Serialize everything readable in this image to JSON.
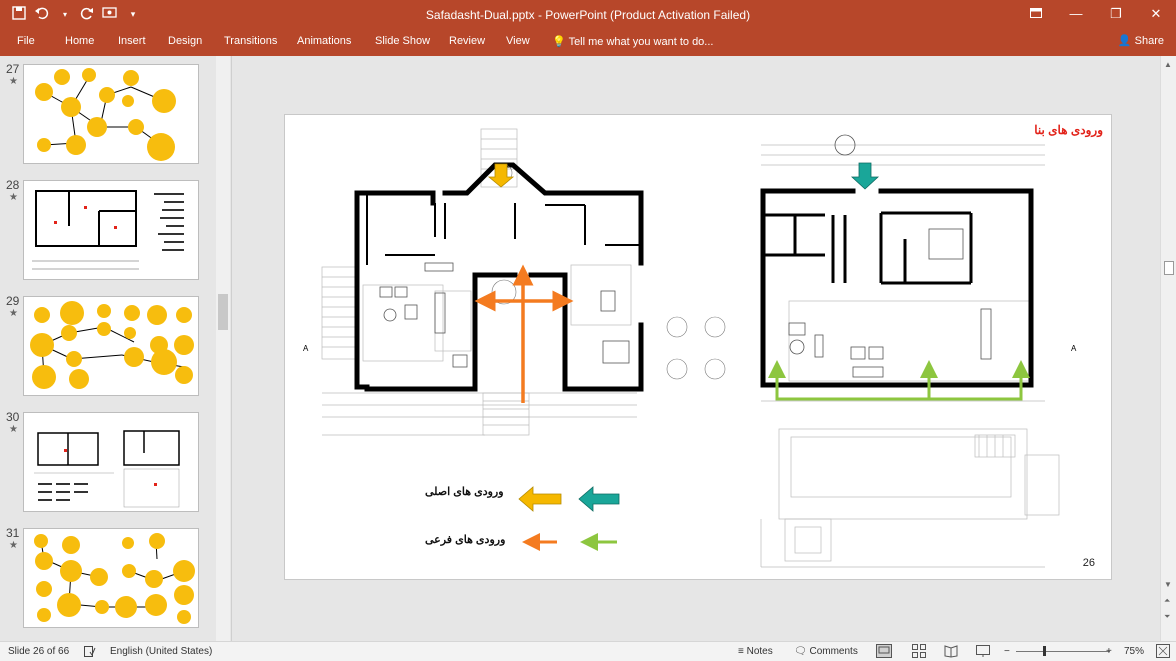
{
  "window": {
    "title": "Safadasht-Dual.pptx - PowerPoint (Product Activation Failed)"
  },
  "quick_access": {
    "save_icon": "save-icon",
    "undo_icon": "undo-icon",
    "redo_icon": "redo-icon",
    "customize_icon": "customize-qat-icon"
  },
  "ribbon": {
    "tabs": [
      "File",
      "Home",
      "Insert",
      "Design",
      "Transitions",
      "Animations",
      "Slide Show",
      "Review",
      "View"
    ],
    "tellme": "Tell me what you want to do...",
    "share": "Share"
  },
  "thumbnails": [
    {
      "number": "27",
      "star": "★"
    },
    {
      "number": "28",
      "star": "★"
    },
    {
      "number": "29",
      "star": "★"
    },
    {
      "number": "30",
      "star": "★"
    },
    {
      "number": "31",
      "star": "★"
    }
  ],
  "slide": {
    "title": "ورودی های بنا",
    "number": "26",
    "legend": {
      "main_label": "ورودی های اصلی",
      "secondary_label": "ورودی های فرعی"
    },
    "marker_left": "A",
    "marker_right": "A"
  },
  "colors": {
    "ribbon": "#b7472a",
    "yellow_arrow": "#f5b800",
    "teal_arrow": "#1aa699",
    "orange_arrow": "#f47b20",
    "green_arrow": "#8dc63f",
    "title_red": "#e2231a",
    "bubble_yellow": "#f7bd0e"
  },
  "status": {
    "slide_info": "Slide 26 of 66",
    "language": "English (United States)",
    "notes": "Notes",
    "comments": "Comments",
    "zoom": "75%"
  }
}
